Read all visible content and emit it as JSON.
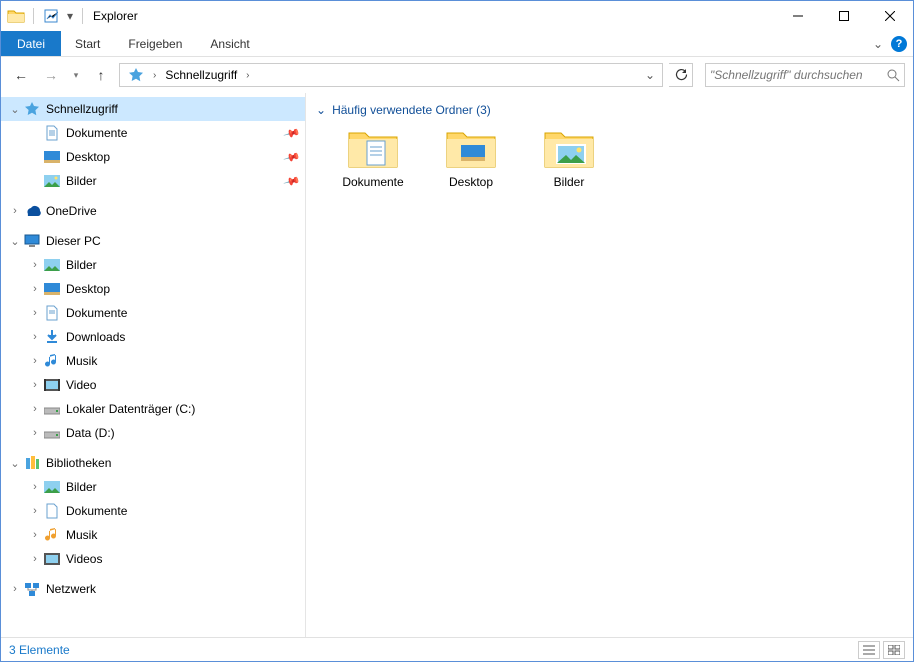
{
  "window": {
    "title": "Explorer"
  },
  "ribbon": {
    "file": "Datei",
    "tabs": [
      "Start",
      "Freigeben",
      "Ansicht"
    ]
  },
  "nav": {
    "breadcrumb_root": "Schnellzugriff",
    "search_placeholder": "\"Schnellzugriff\" durchsuchen"
  },
  "tree": {
    "quickaccess": {
      "label": "Schnellzugriff",
      "items": [
        {
          "label": "Dokumente",
          "icon": "document"
        },
        {
          "label": "Desktop",
          "icon": "desktop"
        },
        {
          "label": "Bilder",
          "icon": "pictures"
        }
      ]
    },
    "onedrive": {
      "label": "OneDrive"
    },
    "thispc": {
      "label": "Dieser PC",
      "items": [
        {
          "label": "Bilder",
          "icon": "pictures"
        },
        {
          "label": "Desktop",
          "icon": "desktop"
        },
        {
          "label": "Dokumente",
          "icon": "document"
        },
        {
          "label": "Downloads",
          "icon": "downloads"
        },
        {
          "label": "Musik",
          "icon": "music"
        },
        {
          "label": "Video",
          "icon": "video"
        },
        {
          "label": "Lokaler Datenträger (C:)",
          "icon": "drive"
        },
        {
          "label": "Data (D:)",
          "icon": "drive"
        }
      ]
    },
    "libraries": {
      "label": "Bibliotheken",
      "items": [
        {
          "label": "Bilder",
          "icon": "pictures-lib"
        },
        {
          "label": "Dokumente",
          "icon": "document-lib"
        },
        {
          "label": "Musik",
          "icon": "music-lib"
        },
        {
          "label": "Videos",
          "icon": "video-lib"
        }
      ]
    },
    "network": {
      "label": "Netzwerk"
    }
  },
  "content": {
    "group_label": "Häufig verwendete Ordner (3)",
    "folders": [
      {
        "label": "Dokumente",
        "icon": "document"
      },
      {
        "label": "Desktop",
        "icon": "desktop"
      },
      {
        "label": "Bilder",
        "icon": "pictures"
      }
    ]
  },
  "status": {
    "text": "3 Elemente"
  }
}
